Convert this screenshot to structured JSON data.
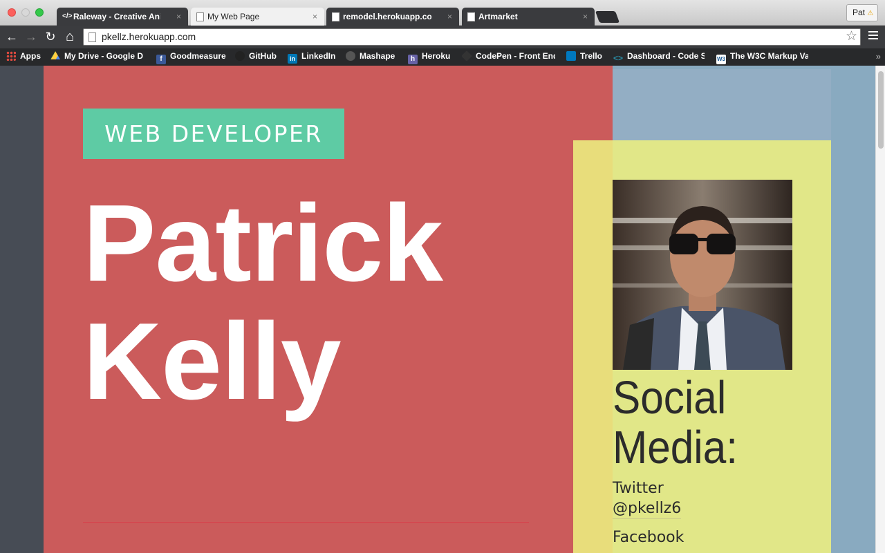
{
  "tabs": [
    {
      "label": "Raleway - Creative Animat",
      "icon": "code-icon"
    },
    {
      "label": "My Web Page",
      "icon": "page-icon",
      "active": true
    },
    {
      "label": "remodel.herokuapp.com/pr",
      "icon": "page-icon"
    },
    {
      "label": "Artmarket",
      "icon": "page-icon"
    }
  ],
  "tab_close": "×",
  "profile": {
    "label": "Pat",
    "badge": "⚠"
  },
  "toolbar": {
    "back": "←",
    "forward": "→",
    "reload": "↻",
    "home": "⌂",
    "url": "pkellz.herokuapp.com",
    "star": "☆"
  },
  "bookmarks": [
    {
      "label": "Apps",
      "icon": "apps-grid-icon",
      "color": "#e04a3f"
    },
    {
      "label": "My Drive - Google D",
      "icon": "google-drive-icon",
      "color": "#1da462"
    },
    {
      "label": "Goodmeasure",
      "icon": "facebook-icon",
      "color": "#3b5998"
    },
    {
      "label": "GitHub",
      "icon": "github-icon",
      "color": "#222222"
    },
    {
      "label": "LinkedIn",
      "icon": "linkedin-icon",
      "color": "#0077b5"
    },
    {
      "label": "Mashape",
      "icon": "mashape-icon",
      "color": "#555555"
    },
    {
      "label": "Heroku",
      "icon": "heroku-icon",
      "color": "#6762a6"
    },
    {
      "label": "CodePen - Front End",
      "icon": "codepen-icon",
      "color": "#333333"
    },
    {
      "label": "Trello",
      "icon": "trello-icon",
      "color": "#0079bf"
    },
    {
      "label": "Dashboard - Code S",
      "icon": "code-school-icon",
      "color": "#2a8fa8"
    },
    {
      "label": "The W3C Markup Va",
      "icon": "w3c-icon",
      "color": "#1a5a96"
    }
  ],
  "bookmarks_more": "»",
  "page": {
    "tag": "WEB DEVELOPER",
    "name_first": "Patrick",
    "name_last": "Kelly",
    "social_heading_1": "Social",
    "social_heading_2": "Media:",
    "social": [
      {
        "network": "Twitter",
        "handle": "@pkellz6"
      },
      {
        "network": "Facebook",
        "handle": ""
      }
    ]
  },
  "colors": {
    "red_panel": "#cb5b5b",
    "teal_tag": "#5ecba4",
    "yellow_panel": "#eaed86",
    "blue_bg": "#89aac0",
    "dark_bg": "#474c55"
  }
}
